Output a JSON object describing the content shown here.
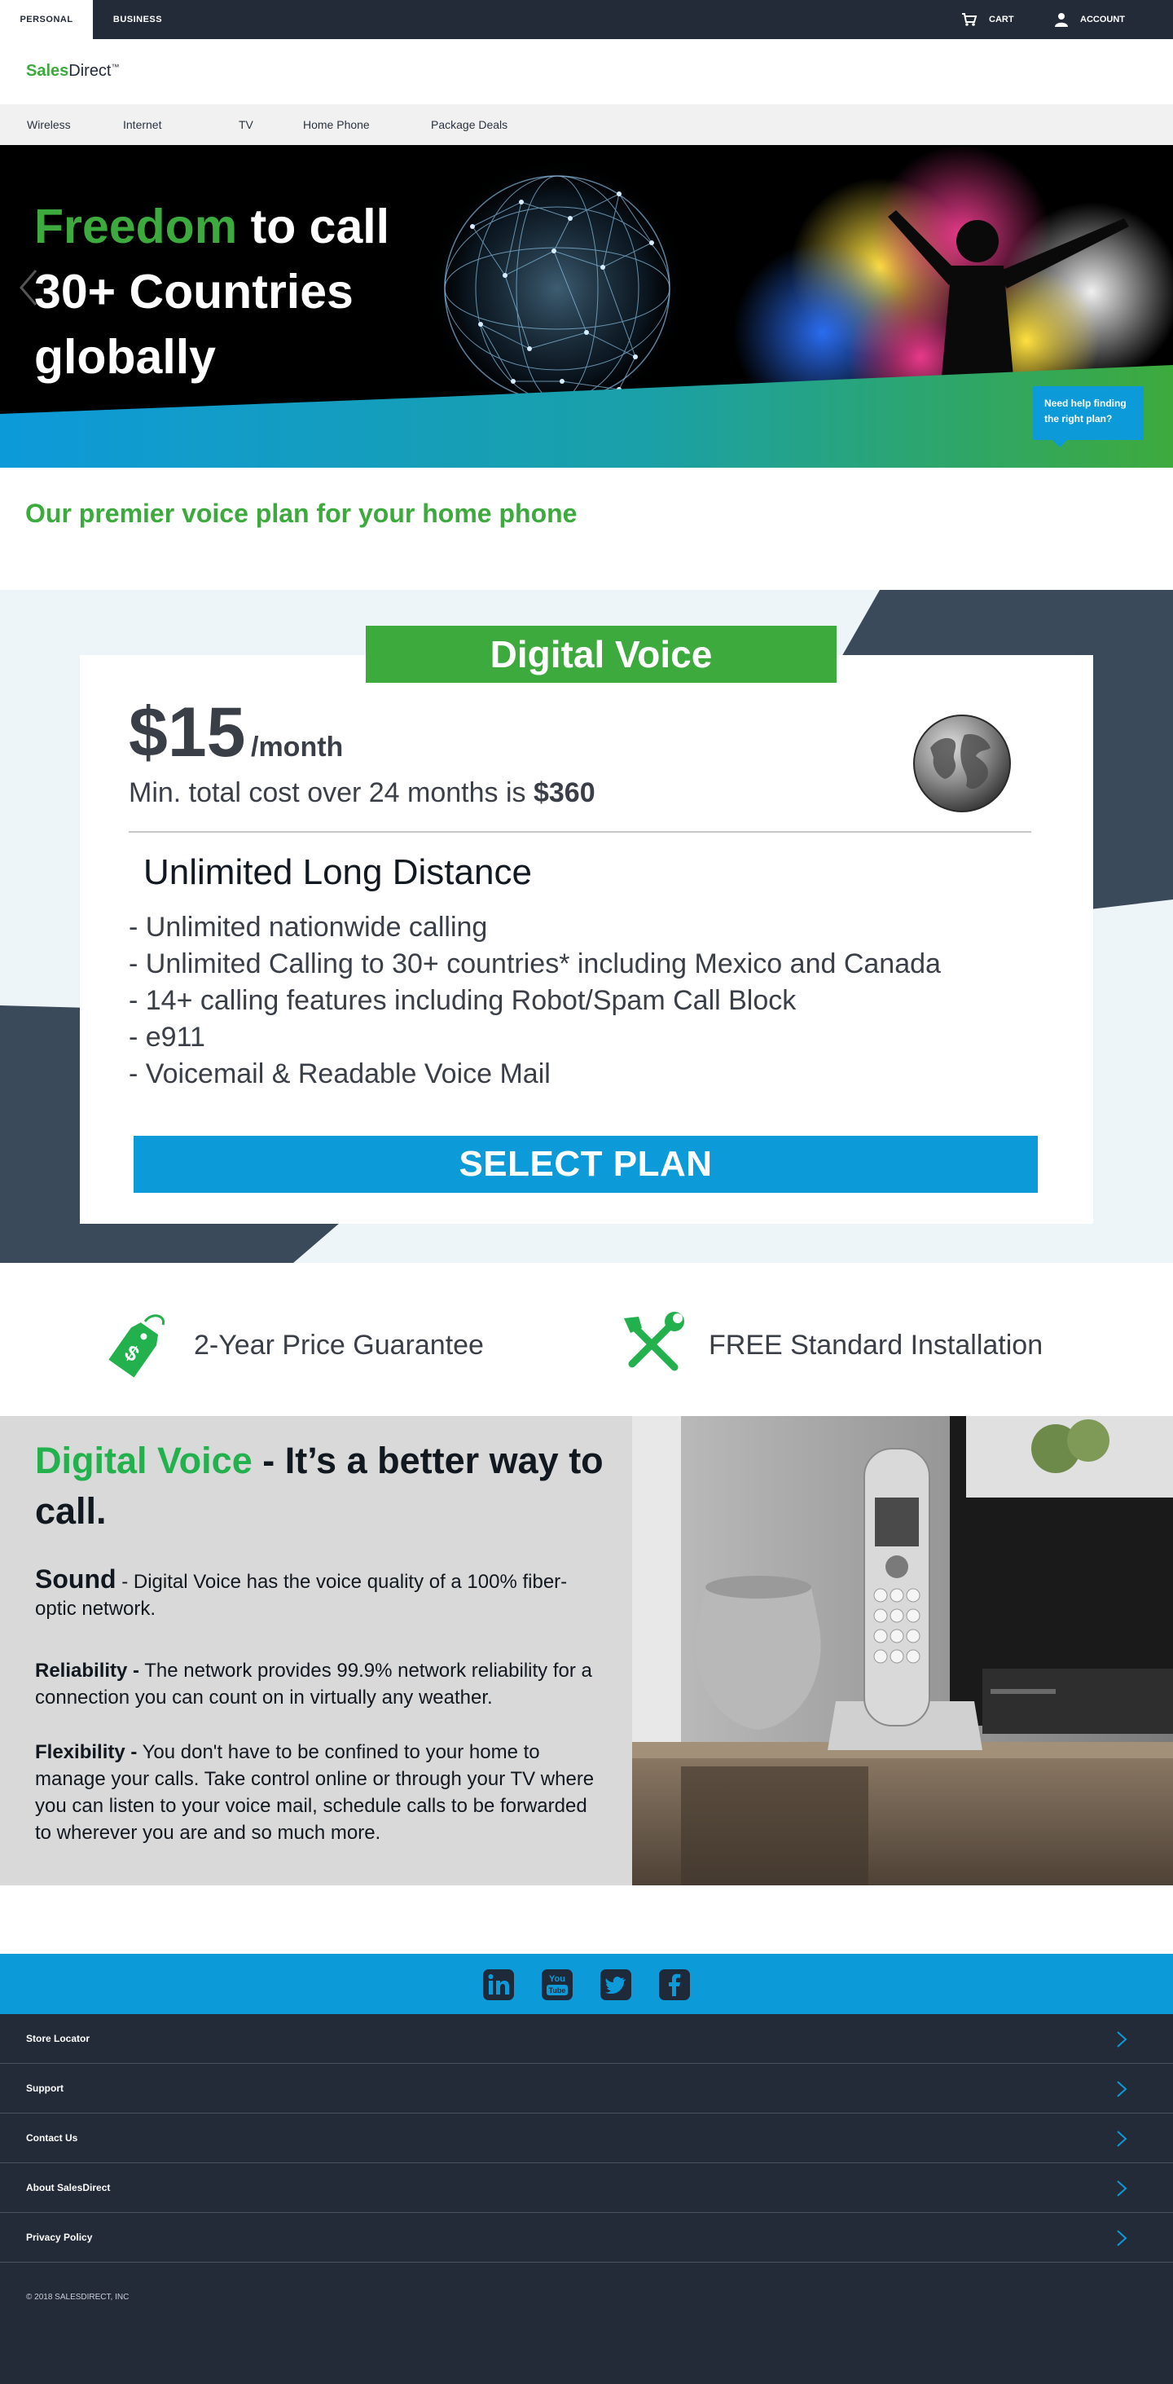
{
  "topbar": {
    "personal": "PERSONAL",
    "business": "BUSINESS",
    "cart": "CART",
    "account": "ACCOUNT"
  },
  "logo": {
    "part1": "Sales",
    "part2": "Direct",
    "tm": "™"
  },
  "nav": {
    "items": [
      {
        "label": "Wireless"
      },
      {
        "label": "Internet"
      },
      {
        "label": "TV"
      },
      {
        "label": "Home Phone"
      },
      {
        "label": "Package Deals"
      }
    ]
  },
  "hero": {
    "title_green": "Freedom",
    "title_rest": " to call 30+ Countries globally",
    "help_text": "Need help finding the right plan?"
  },
  "premier_heading": "Our premier voice plan for your home phone",
  "plan": {
    "name": "Digital Voice",
    "price": "$15",
    "per": "/month",
    "min_cost_text": "Min. total cost over 24 months is ",
    "min_cost_value": "$360",
    "subtitle": "Unlimited Long Distance",
    "features": [
      "- Unlimited nationwide calling",
      "- Unlimited Calling to 30+ countries* including Mexico and Canada",
      "- 14+ calling features including Robot/Spam Call Block",
      "- e911",
      "- Voicemail & Readable Voice Mail"
    ],
    "cta": "SELECT PLAN"
  },
  "benefits": [
    {
      "label": "2-Year Price Guarantee",
      "icon": "price-tag-icon"
    },
    {
      "label": "FREE Standard Installation",
      "icon": "tools-icon"
    }
  ],
  "info": {
    "title_green": "Digital Voice",
    "title_rest": " - It’s a better way to call.",
    "sound_lead": "Sound",
    "sound_text": " - Digital Voice has the voice quality of a 100% fiber-optic network.",
    "reliability_lead": "Reliability -",
    "reliability_text": " The network provides 99.9% network reliability for a connection you can count on in virtually any weather.",
    "flexibility_lead": "Flexibility -",
    "flexibility_text": " You don't have to be confined to your home to manage your calls. Take control online or through your TV where you can listen to your voice mail, schedule calls to be forwarded to wherever you are and so much more."
  },
  "social": [
    "linkedin-icon",
    "youtube-icon",
    "twitter-icon",
    "facebook-icon"
  ],
  "footer": {
    "links": [
      {
        "label": "Store Locator"
      },
      {
        "label": "Support"
      },
      {
        "label": "Contact Us"
      },
      {
        "label": "About SalesDirect"
      },
      {
        "label": "Privacy Policy"
      }
    ],
    "copyright": "© 2018 SALESDIRECT, INC"
  },
  "colors": {
    "brand_green": "#3daa3d",
    "brand_blue": "#0d9ad9",
    "dark_navy": "#232b38"
  }
}
